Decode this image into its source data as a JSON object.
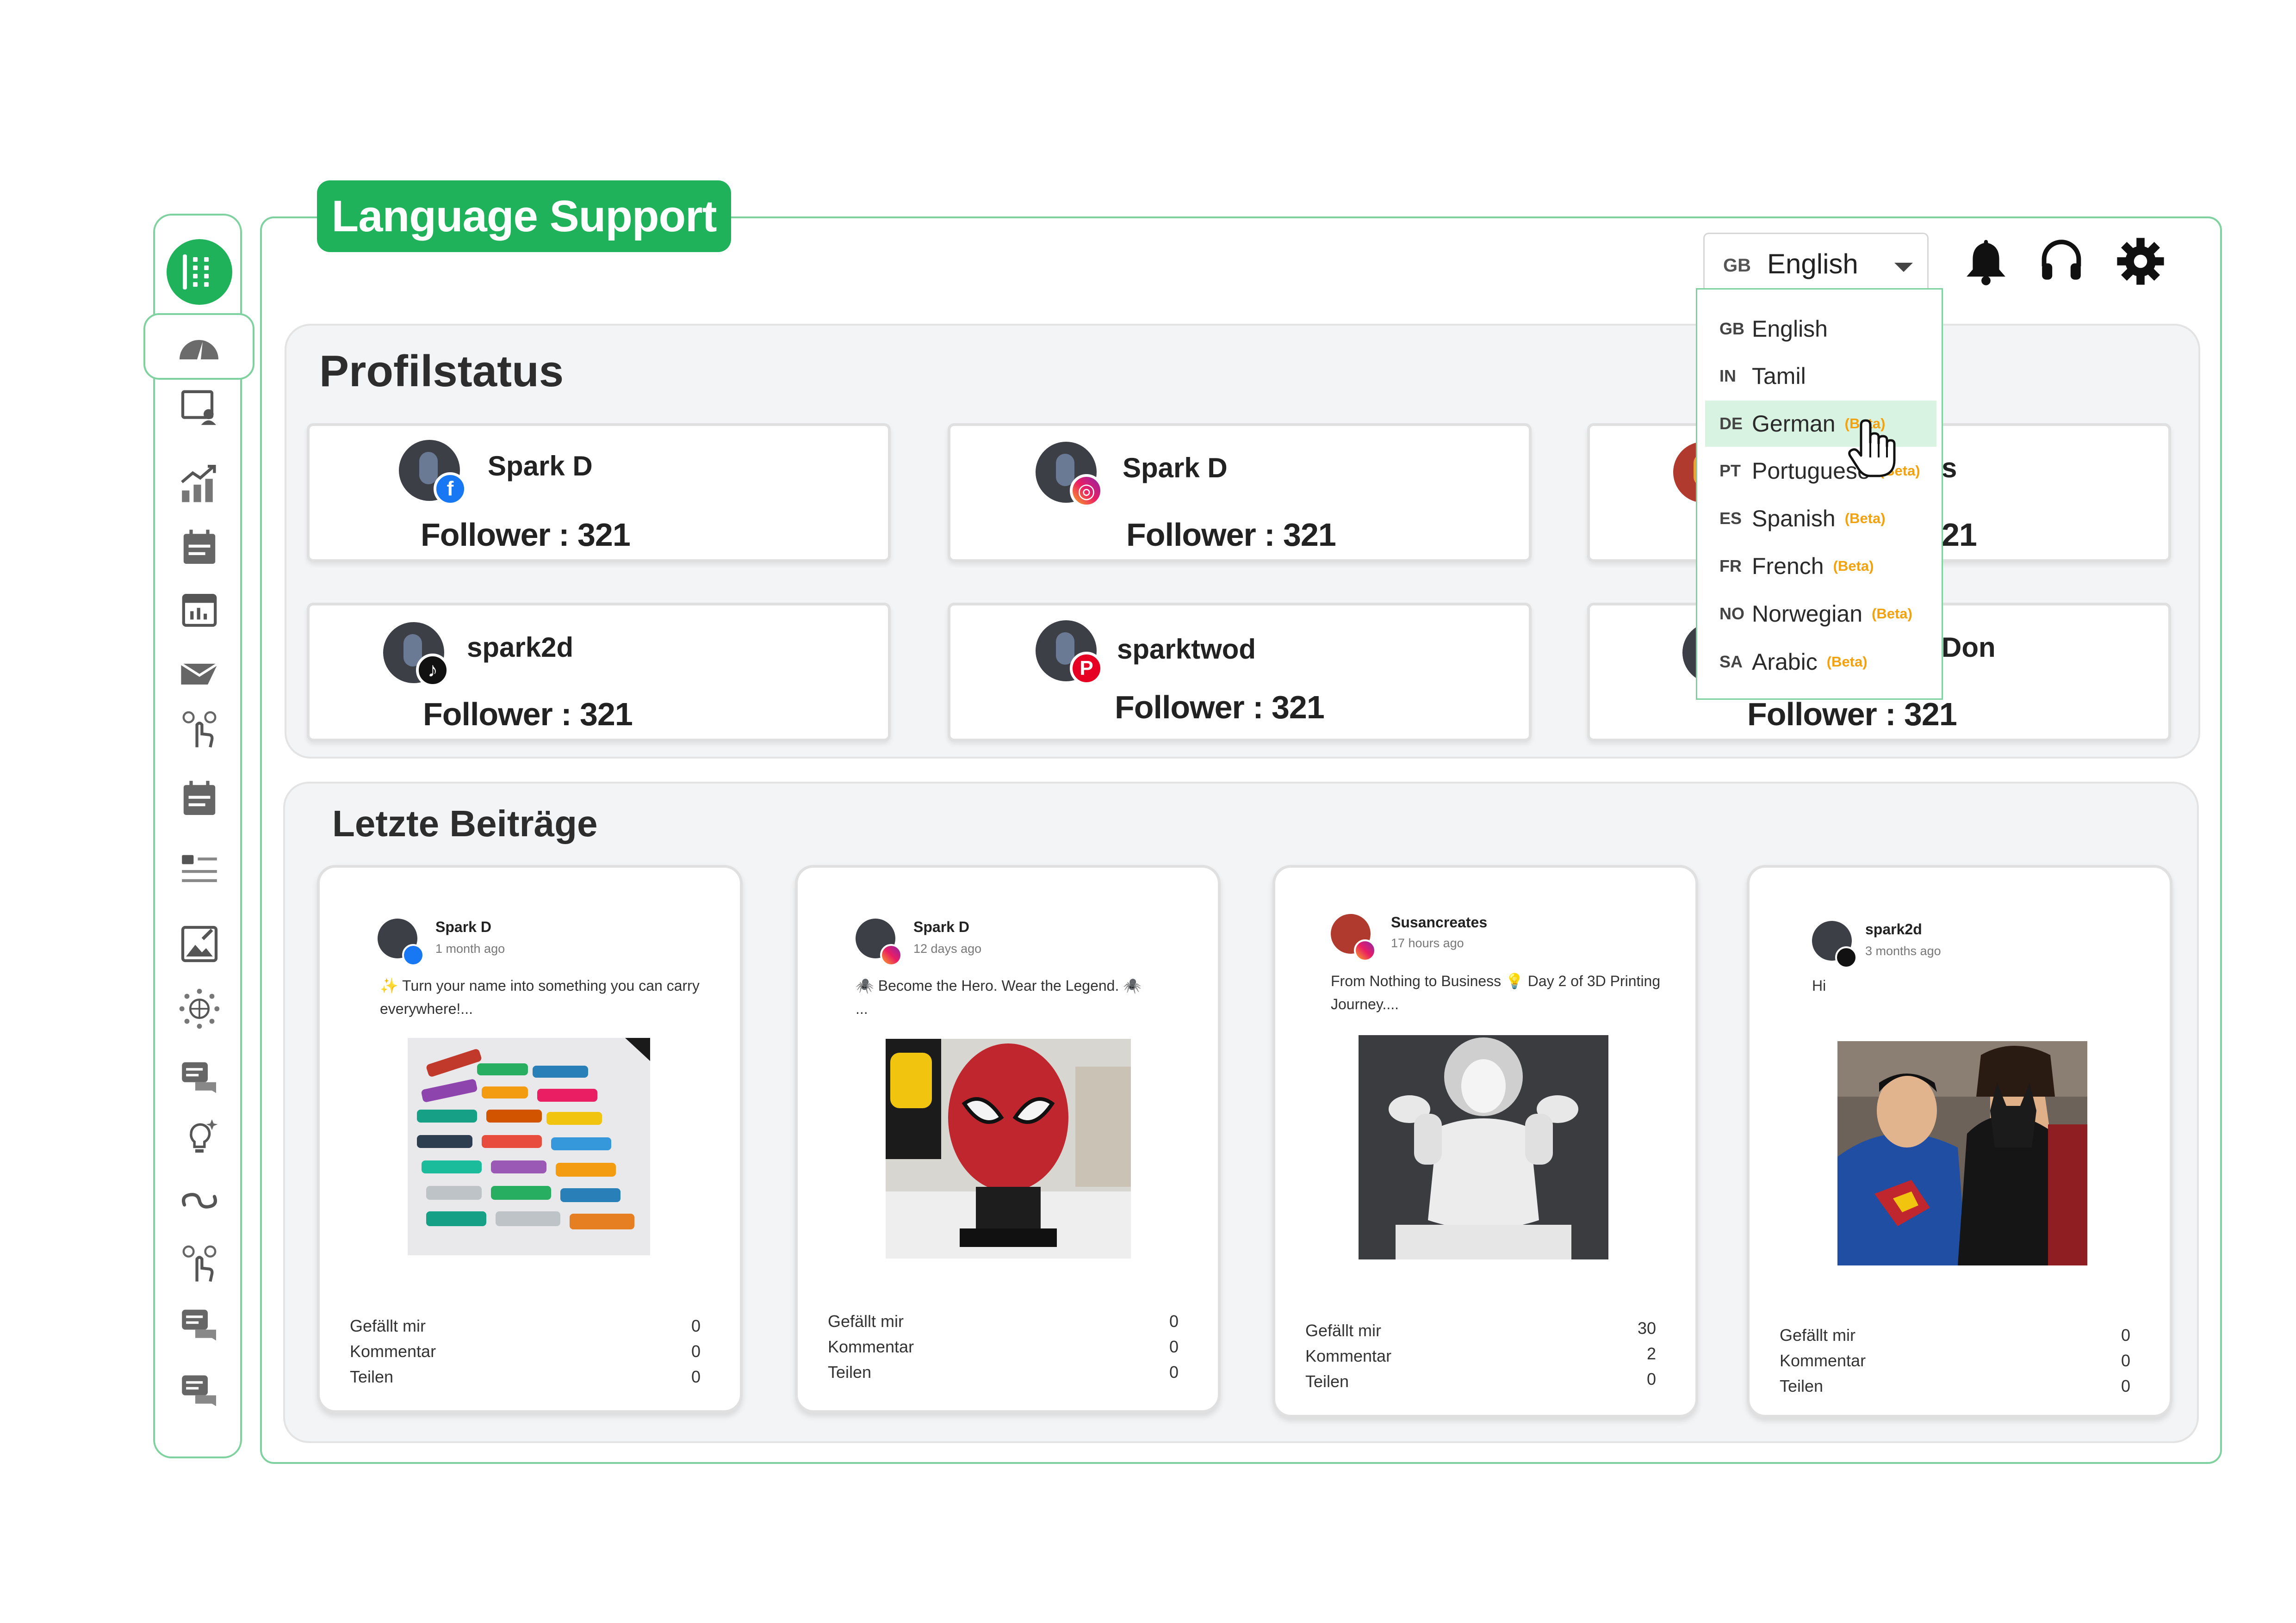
{
  "banner": "Language Support",
  "colors": {
    "brand_green": "#1fb25a",
    "border_green": "#7fd29f",
    "beta_orange": "#f2a20f"
  },
  "sidebar": {
    "items": [
      "grid-menu-icon",
      "dashboard-gauge-icon",
      "profile-board-icon",
      "analytics-icon",
      "calendar-list-icon",
      "calendar-icon",
      "send-message-icon",
      "touch-gesture-icon",
      "schedule-icon",
      "list-icon",
      "image-edit-icon",
      "network-globe-icon",
      "chat-icon",
      "idea-bulb-icon",
      "link-icon",
      "touch-gesture-icon",
      "chat-icon",
      "chat-icon"
    ]
  },
  "topbar": {
    "language": {
      "code": "GB",
      "name": "English"
    },
    "icons": [
      "bell-icon",
      "headset-icon",
      "gear-icon"
    ]
  },
  "language_menu": {
    "items": [
      {
        "code": "GB",
        "name": "English",
        "beta": ""
      },
      {
        "code": "IN",
        "name": "Tamil",
        "beta": ""
      },
      {
        "code": "DE",
        "name": "German",
        "beta": "(Beta)"
      },
      {
        "code": "PT",
        "name": "Portuguese",
        "beta": "(Beta)"
      },
      {
        "code": "ES",
        "name": "Spanish",
        "beta": "(Beta)"
      },
      {
        "code": "FR",
        "name": "French",
        "beta": "(Beta)"
      },
      {
        "code": "NO",
        "name": "Norwegian",
        "beta": "(Beta)"
      },
      {
        "code": "SA",
        "name": "Arabic",
        "beta": "(Beta)"
      }
    ],
    "highlighted": "German"
  },
  "profile_status": {
    "title": "Profilstatus",
    "cards": [
      {
        "name": "Spark D",
        "network": "facebook",
        "follower": "Follower : 321"
      },
      {
        "name": "Spark D",
        "network": "instagram",
        "follower": "Follower : 321"
      },
      {
        "name": "s",
        "network": "youtube",
        "follower": "21"
      },
      {
        "name": "spark2d",
        "network": "tiktok",
        "follower": "Follower : 321"
      },
      {
        "name": "sparktwod",
        "network": "pinterest",
        "follower": "Follower : 321"
      },
      {
        "name": "Don",
        "network": "x",
        "follower": "Follower : 321"
      }
    ]
  },
  "recent_posts": {
    "title": "Letzte Beiträge",
    "labels": {
      "likes": "Gefällt mir",
      "comments": "Kommentar",
      "shares": "Teilen"
    },
    "posts": [
      {
        "author": "Spark D",
        "network": "facebook",
        "ago": "1 month ago",
        "text": "✨ Turn your name into something you can carry everywhere!...",
        "likes": "0",
        "comments": "0",
        "shares": "0"
      },
      {
        "author": "Spark D",
        "network": "instagram",
        "ago": "12 days ago",
        "text": "🕷️ Become the Hero. Wear the Legend. 🕷️ ...",
        "likes": "0",
        "comments": "0",
        "shares": "0"
      },
      {
        "author": "Susancreates",
        "network": "instagram",
        "ago": "17 hours ago",
        "text": "From Nothing to Business 💡 Day 2 of 3D Printing Journey....",
        "likes": "30",
        "comments": "2",
        "shares": "0"
      },
      {
        "author": "spark2d",
        "network": "tiktok",
        "ago": "3 months ago",
        "text": "Hi",
        "likes": "0",
        "comments": "0",
        "shares": "0"
      }
    ]
  }
}
